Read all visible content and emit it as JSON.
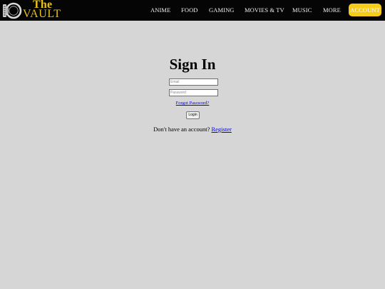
{
  "header": {
    "logo": {
      "top_text": "The",
      "bottom_text": "VAULT",
      "emblem_icon": "vault-door-icon"
    },
    "nav": [
      {
        "id": "anime",
        "label": "ANIME"
      },
      {
        "id": "food",
        "label": "FOOD"
      },
      {
        "id": "gaming",
        "label": "GAMING"
      },
      {
        "id": "movies-tv",
        "label": "MOVIES & TV"
      },
      {
        "id": "music",
        "label": "MUSIC"
      },
      {
        "id": "more",
        "label": "MORE"
      }
    ],
    "account_label": "ACCOUNT"
  },
  "signin": {
    "title": "Sign In",
    "email_placeholder": "Email",
    "password_placeholder": "Password",
    "forgot_label": "Forgot Password?",
    "login_label": "Login",
    "no_account_text": "Don't have an account?",
    "register_label": "Register"
  },
  "colors": {
    "navbar_bg": "#050505",
    "page_bg": "#d6d6d6",
    "brand_gold": "#e6c21a",
    "account_button": "#f5cc1a",
    "link": "#0000ee"
  }
}
